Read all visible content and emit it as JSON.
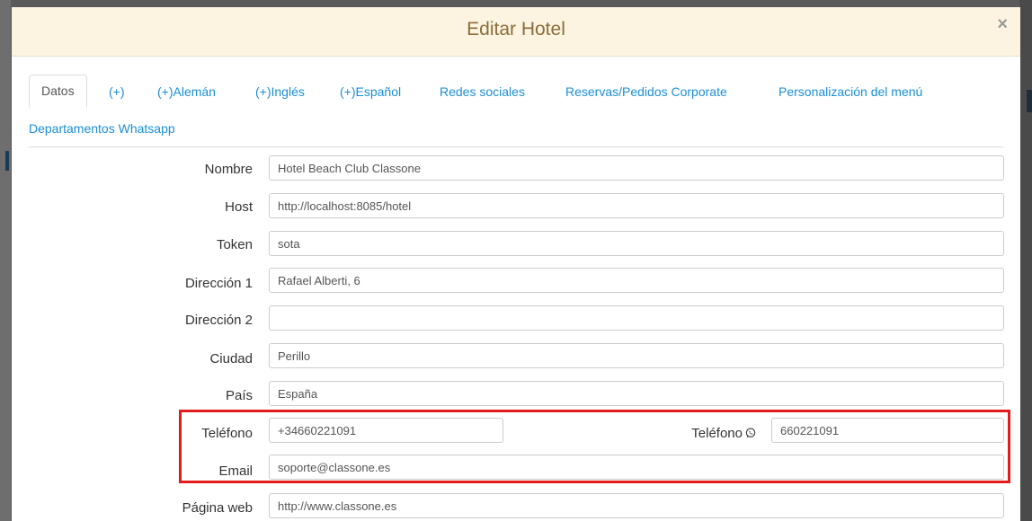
{
  "modal": {
    "title": "Editar Hotel",
    "close_symbol": "×"
  },
  "tabs": [
    {
      "label": "Datos",
      "active": true
    },
    {
      "label": "(+)"
    },
    {
      "label": "(+)Alemán"
    },
    {
      "label": "(+)Inglés"
    },
    {
      "label": "(+)Español"
    },
    {
      "label": "Redes sociales"
    },
    {
      "label": "Reservas/Pedidos Corporate"
    },
    {
      "label": "Personalización del menú"
    },
    {
      "label": "Departamentos Whatsapp"
    }
  ],
  "form": {
    "nombre": {
      "label": "Nombre",
      "value": "Hotel Beach Club Classone"
    },
    "host": {
      "label": "Host",
      "value": "http://localhost:8085/hotel"
    },
    "token": {
      "label": "Token",
      "value": "sota"
    },
    "direccion1": {
      "label": "Dirección 1",
      "value": "Rafael Alberti, 6"
    },
    "direccion2": {
      "label": "Dirección 2",
      "value": ""
    },
    "ciudad": {
      "label": "Ciudad",
      "value": "Perillo"
    },
    "pais": {
      "label": "País",
      "value": "España"
    },
    "telefono": {
      "label": "Teléfono",
      "value": "+34660221091"
    },
    "telefono_whatsapp": {
      "label": "Teléfono",
      "value": "660221091",
      "icon": "whatsapp-icon"
    },
    "email": {
      "label": "Email",
      "value": "soporte@classone.es"
    },
    "pagina_web": {
      "label": "Página web",
      "value": "http://www.classone.es"
    }
  },
  "colors": {
    "header_bg": "#fcf4e0",
    "title": "#8a6d3b",
    "link": "#1a8fd6",
    "highlight": "#e21b1b"
  }
}
